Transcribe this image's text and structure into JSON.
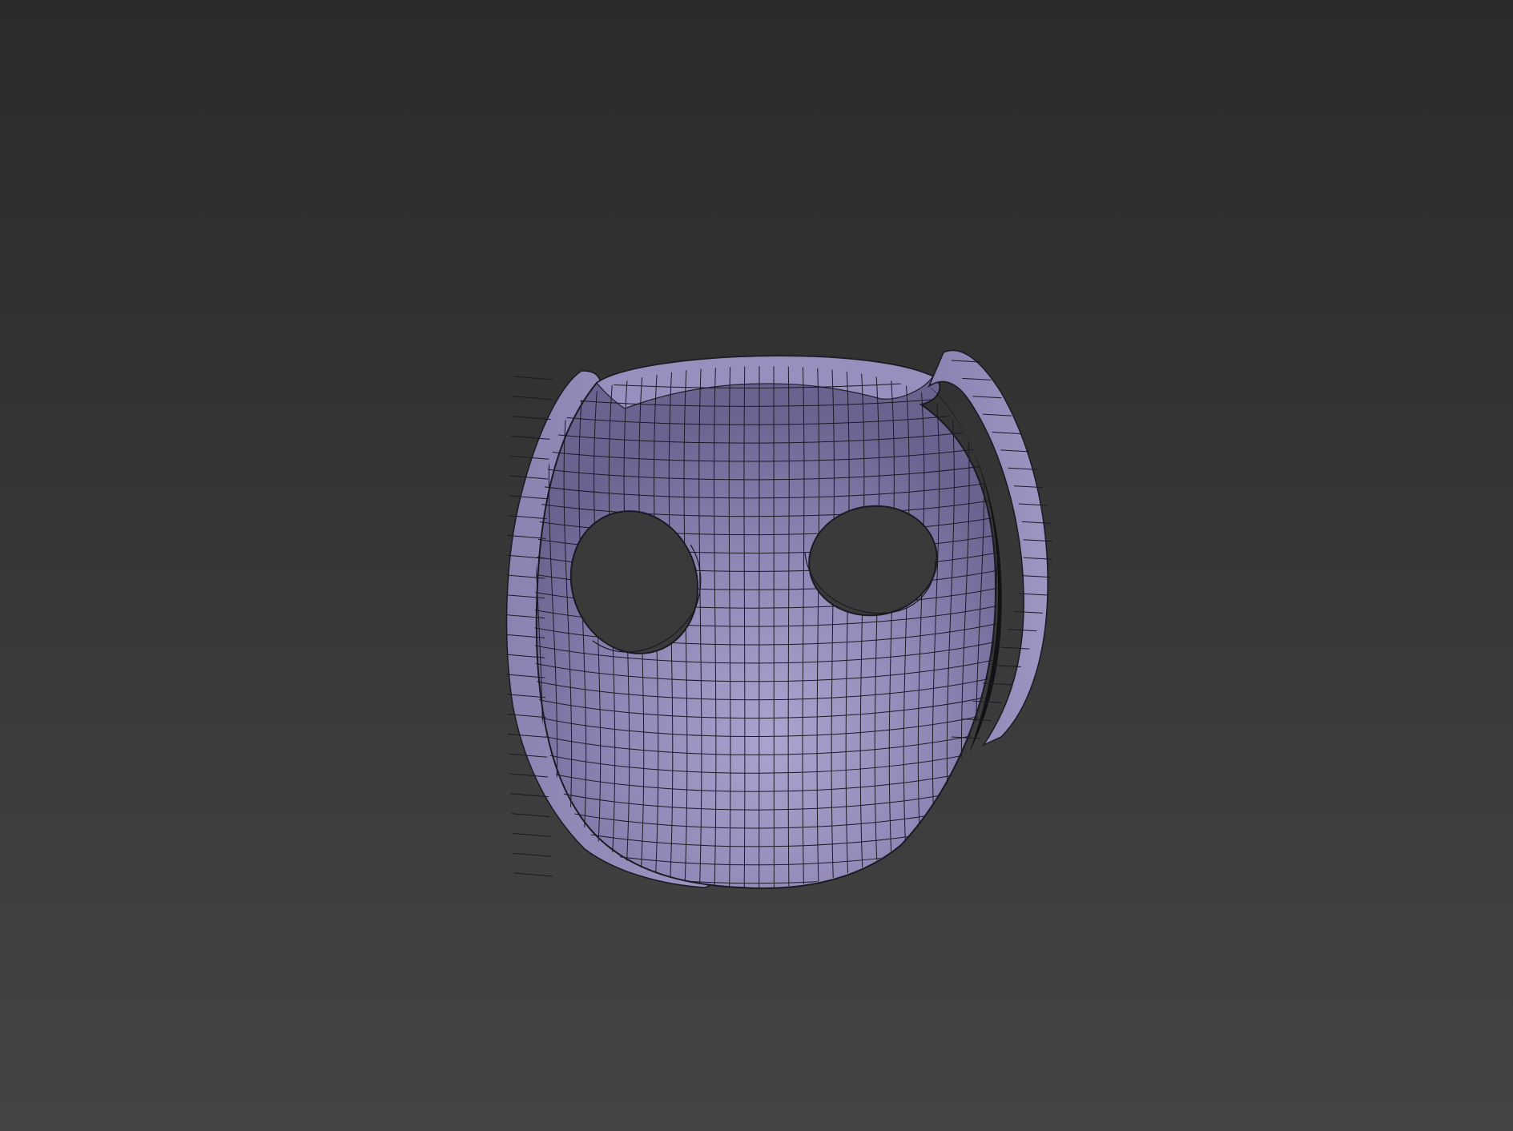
{
  "viewport": {
    "label": "",
    "background_top": "#2b2b2b",
    "background_bottom": "#444444"
  },
  "model": {
    "type": "mask-mesh",
    "display_mode": "shaded-with-wireframe",
    "shade_color": "#9389b8",
    "shade_highlight": "#aea6cf",
    "shade_shadow": "#5f5880",
    "wire_color": "#1a1a22",
    "eye_hole_color": "#3a3a3a"
  }
}
